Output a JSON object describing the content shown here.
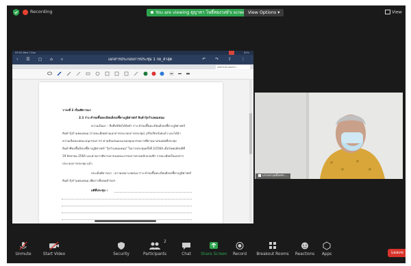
{
  "topbar": {
    "recording_label": "Recording",
    "viewing_banner": "You are viewing ยุญาคา โพธิ์ทองวงษ์'s screen",
    "view_options_label": "View Options",
    "view_label": "View"
  },
  "shared_screen": {
    "status_left": "09:54  Wed 1 Sep",
    "status_right": "81%",
    "document_title": "เอกสารประกอบการประชุม 1 กย_ล่าสุด",
    "tab_label": "เอกสารประกอบการ...",
    "page_lines": [
      "วาระที่ 2   เรื่องพิจารณา",
      "2.1  ร่าง คำขอขึ้นทะเบียนสิ่งบ่งชี้ทางภูมิศาสตร์ สินค้ารุ้งกำเเพงแหนม",
      "ความเป็นมา  :  สืบที่บริษัทได้จัดทำ ร่าง คำขอขึ้นทะเบียนสิ่งบ่งชี้ทางภูมิศาสตร์",
      "สินค้ารุ้งกำเเพงแหนม (รายละเอียดตามเอกสารประกอบการประชุม) เสร็จเรียบร้อยแล้ว และได้นำ",
      "ความเห็นของคณะอนุกรรมการฯ ตามข้อเสนอแนะของคุณกรรมการที่ผ่านมาเสนอต่อที่ประชุม",
      "สินค้าที่ขอขึ้นสิ่งบ่งชี้ทางภูมิศาสตร์ \"รุ้งกำเเพงแหนม\" ในการประชุมครั้งที่ 2/2564 เมื่อวันพฤหัสบดีที่",
      "19 สิงหาคม 2564 และผ่านการพิจารณาของคณะกรรมการตามหลักเกณฑ์ฯ รายละเอียดในเอกสาร",
      "ประกอบการประชุม แล้ว",
      "ประเด็นพิจารณา  :  ความเหมาะสมของ ร่าง คำขอขึ้นทะเบียนสิ่งบ่งชี้ทางภูมิศาสตร์",
      "สินค้ารุ้งกำเเพงแหนม เพื่อการยื่นขอคำขอฯ",
      "มติที่ประชุม  :"
    ]
  },
  "participant": {
    "name": "บรรเทาฤทธิ์เดชา..."
  },
  "toolbar": {
    "unmute": "Unmute",
    "start_video": "Start Video",
    "security": "Security",
    "participants": "Participants",
    "participants_count": "2",
    "chat": "Chat",
    "share_screen": "Share Screen",
    "record": "Record",
    "breakout_rooms": "Breakout Rooms",
    "reactions": "Reactions",
    "apps": "Apps",
    "leave": "Leave"
  },
  "colors": {
    "window_bg": "#1a1a1a",
    "banner_green": "#2ea44f",
    "leave_red": "#d9342b",
    "share_icon_green": "#2ea44f",
    "doc_header": "#2b3d5c"
  }
}
